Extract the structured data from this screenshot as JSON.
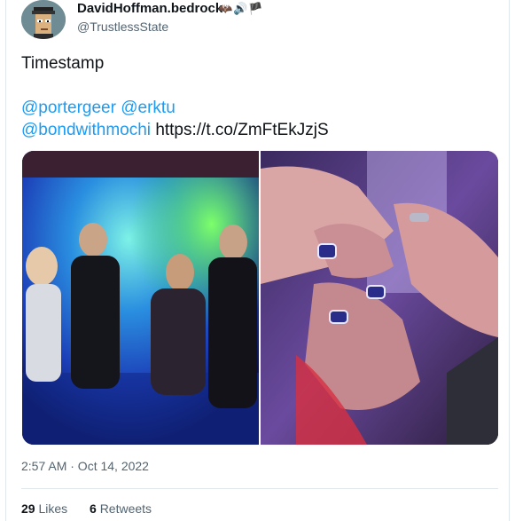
{
  "author": {
    "display_name": "DavidHoffman.bedrock",
    "badges": "🦇🔊🏴",
    "handle": "@TrustlessState",
    "avatar_icon": "pixel-punk-avatar"
  },
  "tweet": {
    "text": "Timestamp",
    "mentions": [
      "@portergeer",
      "@erktu",
      "@bondwithmochi"
    ],
    "link": "https://t.co/ZmFtEkJzjS"
  },
  "media": {
    "photos": [
      {
        "icon": "group-photo"
      },
      {
        "icon": "rings-photo"
      }
    ]
  },
  "meta": {
    "timestamp": "2:57 AM · Oct 14, 2022"
  },
  "stats": {
    "likes_count": "29",
    "likes_label": "Likes",
    "retweets_count": "6",
    "retweets_label": "Retweets"
  },
  "colors": {
    "link": "#1d9bf0",
    "secondary_text": "#536471",
    "border": "#e1e8ed"
  }
}
